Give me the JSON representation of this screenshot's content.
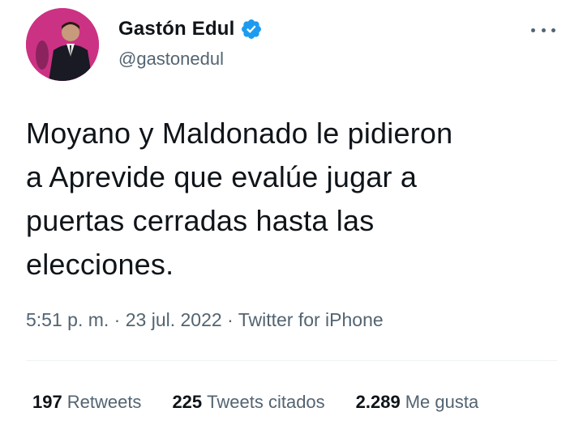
{
  "author": {
    "name": "Gastón Edul",
    "handle": "@gastonedul",
    "verified_icon": "verified-badge-icon",
    "avatar_icon": "profile-photo"
  },
  "tweet": {
    "text": "Moyano y Maldonado le pidieron\na Aprevide que evalúe jugar a\npuertas cerradas hasta las\nelecciones.",
    "time": "5:51 p. m.",
    "sep": "·",
    "date": "23 jul. 2022",
    "source": "Twitter for iPhone"
  },
  "stats": {
    "retweets_count": "197",
    "retweets_label": "Retweets",
    "quotes_count": "225",
    "quotes_label": "Tweets citados",
    "likes_count": "2.289",
    "likes_label": "Me gusta"
  },
  "colors": {
    "text": "#0f1419",
    "secondary": "#536471",
    "verified": "#1d9bf0",
    "divider": "#eff3f4"
  }
}
